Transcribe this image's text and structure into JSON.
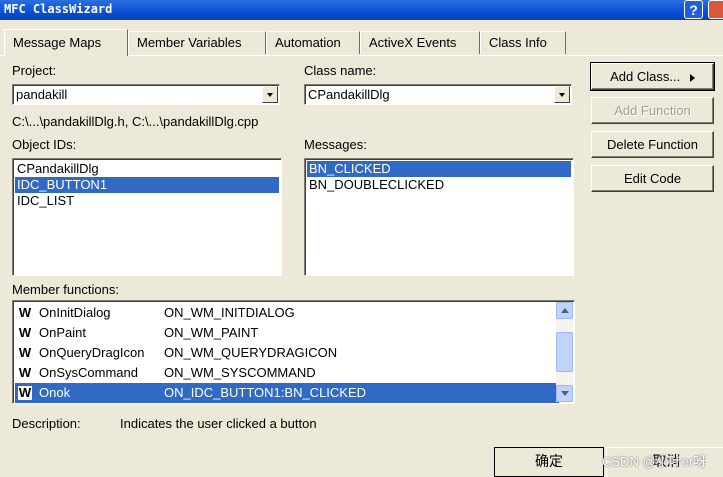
{
  "window": {
    "title": "MFC ClassWizard",
    "help": "?"
  },
  "tabs": [
    {
      "label": "Message Maps",
      "active": true
    },
    {
      "label": "Member Variables"
    },
    {
      "label": "Automation"
    },
    {
      "label": "ActiveX Events"
    },
    {
      "label": "Class Info"
    }
  ],
  "project": {
    "label": "Project:",
    "value": "pandakill"
  },
  "class_name": {
    "label": "Class name:",
    "value": "CPandakillDlg"
  },
  "files": "C:\\...\\pandakillDlg.h, C:\\...\\pandakillDlg.cpp",
  "object_ids": {
    "label": "Object IDs:",
    "items": [
      "CPandakillDlg",
      "IDC_BUTTON1",
      "IDC_LIST"
    ],
    "selected": 1
  },
  "messages": {
    "label": "Messages:",
    "items": [
      "BN_CLICKED",
      "BN_DOUBLECLICKED"
    ],
    "selected": 0
  },
  "buttons": {
    "add_class": "Add Class...",
    "add_function": "Add Function",
    "delete_function": "Delete Function",
    "edit_code": "Edit Code"
  },
  "member_functions": {
    "label": "Member functions:",
    "icon_letter": "W",
    "rows": [
      {
        "name": "OnInitDialog",
        "handler": "ON_WM_INITDIALOG"
      },
      {
        "name": "OnPaint",
        "handler": "ON_WM_PAINT"
      },
      {
        "name": "OnQueryDragIcon",
        "handler": "ON_WM_QUERYDRAGICON"
      },
      {
        "name": "OnSysCommand",
        "handler": "ON_WM_SYSCOMMAND"
      },
      {
        "name": "Onok",
        "handler": "ON_IDC_BUTTON1:BN_CLICKED",
        "selected": true
      }
    ]
  },
  "description": {
    "label": "Description:",
    "text": "Indicates the user clicked a button"
  },
  "footer": {
    "ok": "确定",
    "cancel": "取消"
  },
  "watermark": "CSDN @小叶er呀",
  "colors": {
    "selection": "#316ac5",
    "titlebar": "#0a4fd4",
    "dialog": "#ece9d8"
  }
}
